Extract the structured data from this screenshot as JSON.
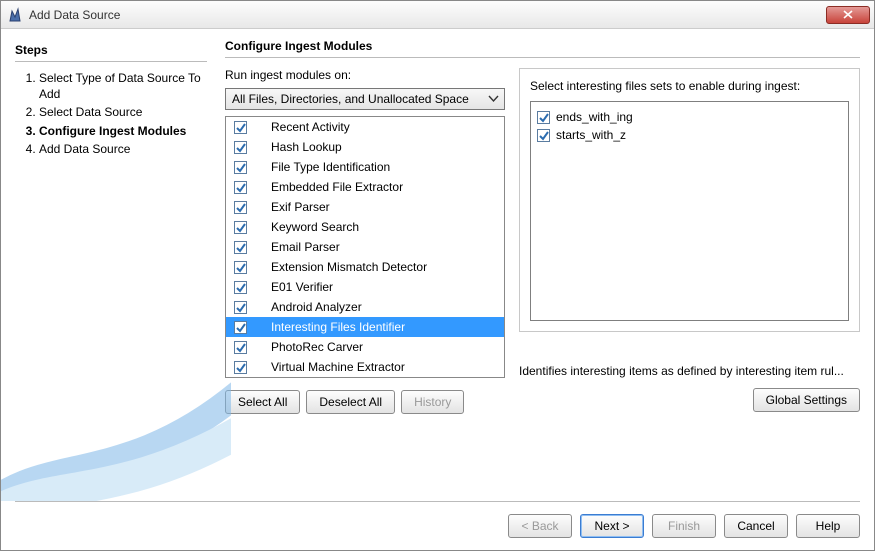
{
  "window": {
    "title": "Add Data Source"
  },
  "steps": {
    "heading": "Steps",
    "items": [
      {
        "label": "Select Type of Data Source To Add",
        "current": false
      },
      {
        "label": "Select Data Source",
        "current": false
      },
      {
        "label": "Configure Ingest Modules",
        "current": true
      },
      {
        "label": "Add Data Source",
        "current": false
      }
    ]
  },
  "main": {
    "heading": "Configure Ingest Modules",
    "runLabel": "Run ingest modules on:",
    "runTargetSelected": "All Files, Directories, and Unallocated Space",
    "modules": [
      {
        "name": "Recent Activity",
        "checked": true,
        "selected": false
      },
      {
        "name": "Hash Lookup",
        "checked": true,
        "selected": false
      },
      {
        "name": "File Type Identification",
        "checked": true,
        "selected": false
      },
      {
        "name": "Embedded File Extractor",
        "checked": true,
        "selected": false
      },
      {
        "name": "Exif Parser",
        "checked": true,
        "selected": false
      },
      {
        "name": "Keyword Search",
        "checked": true,
        "selected": false
      },
      {
        "name": "Email Parser",
        "checked": true,
        "selected": false
      },
      {
        "name": "Extension Mismatch Detector",
        "checked": true,
        "selected": false
      },
      {
        "name": "E01 Verifier",
        "checked": true,
        "selected": false
      },
      {
        "name": "Android Analyzer",
        "checked": true,
        "selected": false
      },
      {
        "name": "Interesting Files Identifier",
        "checked": true,
        "selected": true
      },
      {
        "name": "PhotoRec Carver",
        "checked": true,
        "selected": false
      },
      {
        "name": "Virtual Machine Extractor",
        "checked": true,
        "selected": false
      }
    ],
    "buttons": {
      "selectAll": "Select All",
      "deselectAll": "Deselect All",
      "history": "History"
    },
    "rightGroup": {
      "label": "Select interesting files sets to enable during ingest:",
      "fileSets": [
        {
          "name": "ends_with_ing",
          "checked": true
        },
        {
          "name": "starts_with_z",
          "checked": true
        }
      ],
      "description": "Identifies interesting items as defined by interesting item rul...",
      "globalSettings": "Global Settings"
    }
  },
  "footer": {
    "back": "< Back",
    "next": "Next >",
    "finish": "Finish",
    "cancel": "Cancel",
    "help": "Help"
  }
}
